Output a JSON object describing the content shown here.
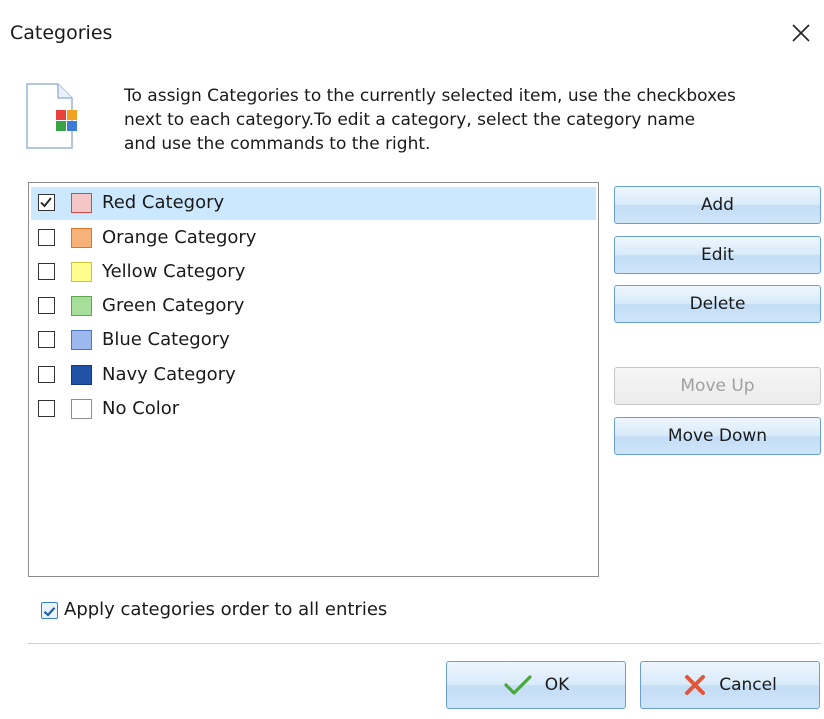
{
  "window": {
    "title": "Categories"
  },
  "description": [
    "To assign Categories to the currently selected item, use the checkboxes",
    "next to each category.To edit a category, select the category name",
    "and use the commands to the right."
  ],
  "categories": [
    {
      "label": "Red Category",
      "checked": true,
      "selected": true,
      "fill": "#f4c7c7",
      "border": "#d04a4a"
    },
    {
      "label": "Orange Category",
      "checked": false,
      "selected": false,
      "fill": "#f7b27a",
      "border": "#d9782a"
    },
    {
      "label": "Yellow Category",
      "checked": false,
      "selected": false,
      "fill": "#fdfd8c",
      "border": "#c9c63a"
    },
    {
      "label": "Green Category",
      "checked": false,
      "selected": false,
      "fill": "#a7df9a",
      "border": "#5fa84f"
    },
    {
      "label": "Blue Category",
      "checked": false,
      "selected": false,
      "fill": "#9cb8ee",
      "border": "#4a74c9"
    },
    {
      "label": "Navy Category",
      "checked": false,
      "selected": false,
      "fill": "#2252a6",
      "border": "#17367a"
    },
    {
      "label": "No Color",
      "checked": false,
      "selected": false,
      "fill": "#ffffff",
      "border": "#8d8d8d"
    }
  ],
  "buttons": {
    "add": "Add",
    "edit": "Edit",
    "delete": "Delete",
    "move_up": "Move Up",
    "move_down": "Move Down",
    "ok": "OK",
    "cancel": "Cancel"
  },
  "apply_order": {
    "label": "Apply categories order to all entries",
    "checked": true
  },
  "icons": {
    "close": "close-icon",
    "document": "categories-document-icon",
    "ok": "checkmark-icon",
    "cancel": "cancel-x-icon"
  }
}
